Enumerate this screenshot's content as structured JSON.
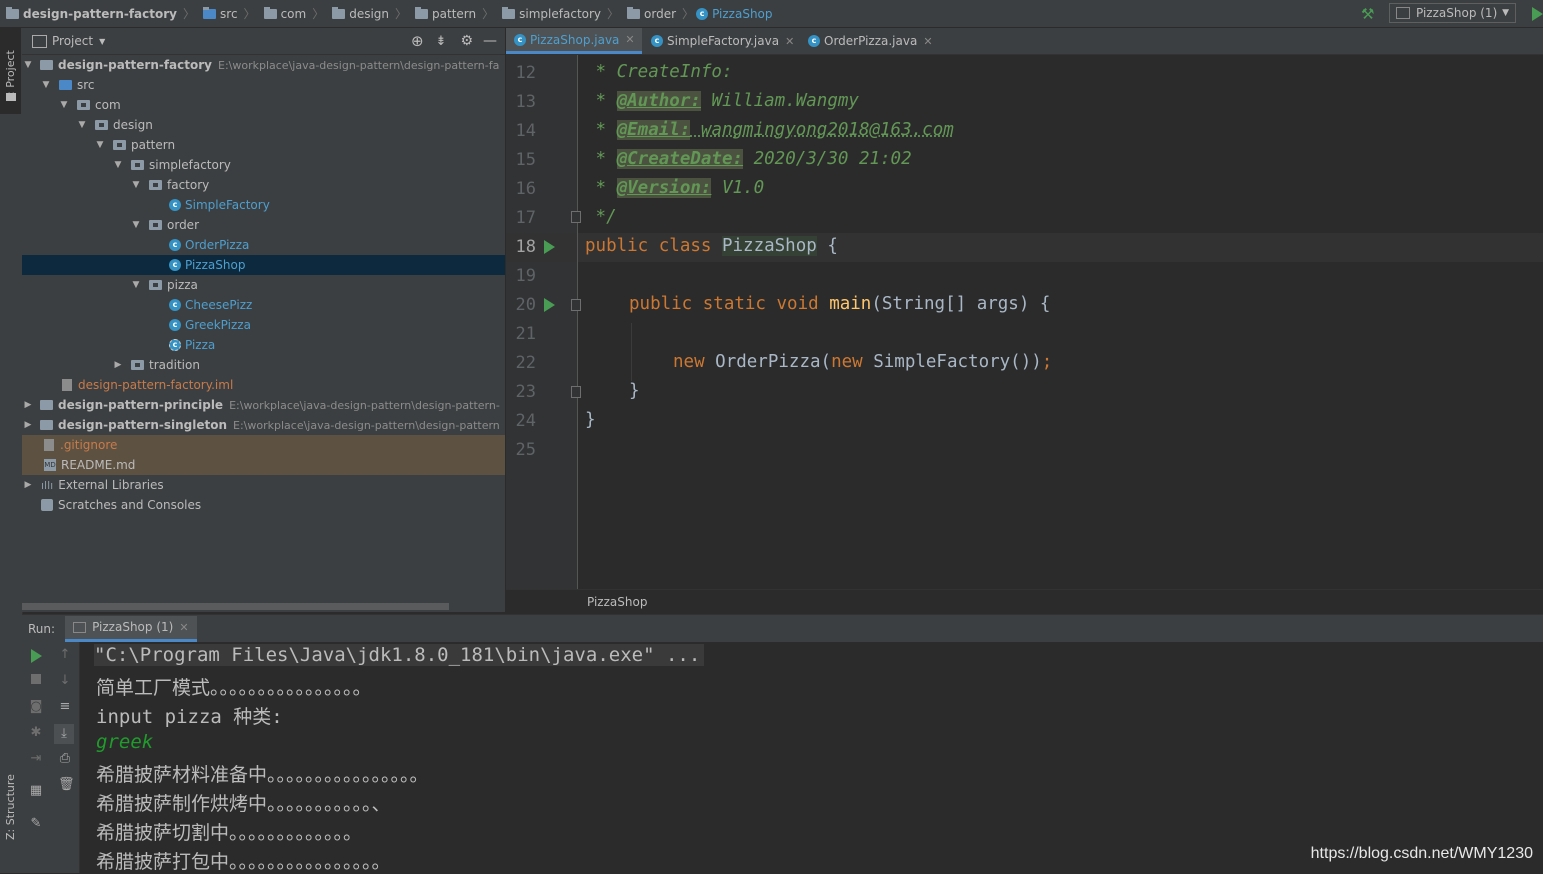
{
  "navbar": {
    "crumbs": [
      "design-pattern-factory",
      "src",
      "com",
      "design",
      "pattern",
      "simplefactory",
      "order",
      "PizzaShop"
    ],
    "run_config": "PizzaShop (1)"
  },
  "left_stripe": {
    "project_label": "1: Project",
    "structure_label": "Z: Structure"
  },
  "project_panel": {
    "title": "Project",
    "tree": [
      {
        "label": "design-pattern-factory",
        "path": "E:\\workplace\\java-design-pattern\\design-pattern-fa"
      },
      {
        "label": "src"
      },
      {
        "label": "com"
      },
      {
        "label": "design"
      },
      {
        "label": "pattern"
      },
      {
        "label": "simplefactory"
      },
      {
        "label": "factory"
      },
      {
        "label": "SimpleFactory"
      },
      {
        "label": "order"
      },
      {
        "label": "OrderPizza"
      },
      {
        "label": "PizzaShop"
      },
      {
        "label": "pizza"
      },
      {
        "label": "CheesePizz"
      },
      {
        "label": "GreekPizza"
      },
      {
        "label": "Pizza"
      },
      {
        "label": "tradition"
      },
      {
        "label": "design-pattern-factory.iml"
      },
      {
        "label": "design-pattern-principle",
        "path": "E:\\workplace\\java-design-pattern\\design-pattern-"
      },
      {
        "label": "design-pattern-singleton",
        "path": "E:\\workplace\\java-design-pattern\\design-pattern"
      },
      {
        "label": ".gitignore"
      },
      {
        "label": "README.md"
      },
      {
        "label": "External Libraries"
      },
      {
        "label": "Scratches and Consoles"
      }
    ]
  },
  "editor": {
    "tabs": [
      "PizzaShop.java",
      "SimpleFactory.java",
      "OrderPizza.java"
    ],
    "line_numbers": [
      "12",
      "13",
      "14",
      "15",
      "16",
      "17",
      "18",
      "19",
      "20",
      "21",
      "22",
      "23",
      "24",
      "25"
    ],
    "code": {
      "l12_star": " * ",
      "l12_text": "CreateInfo:",
      "l13_star": " * ",
      "l13_tag": "@Author:",
      "l13_text": " William.Wangmy",
      "l14_star": " * ",
      "l14_tag": "@Email:",
      "l14_text": " wangmingyong2018@163.com",
      "l15_star": " * ",
      "l15_tag": "@CreateDate:",
      "l15_text": " 2020/3/30 21:02",
      "l16_star": " * ",
      "l16_tag": "@Version:",
      "l16_text": " V1.0",
      "l17": " */",
      "l18_kw": "public class ",
      "l18_name": "PizzaShop",
      "l18_rest": " {",
      "l20_kw": "public static void ",
      "l20_fn": "main",
      "l20_rest": "(String[] args) {",
      "l22_kw1": "new ",
      "l22_a": "OrderPizza(",
      "l22_kw2": "new ",
      "l22_b": "SimpleFactory())",
      "l22_semi": ";",
      "l23": "}",
      "l24": "}"
    },
    "breadcrumb": "PizzaShop"
  },
  "run_panel": {
    "label": "Run:",
    "tab": "PizzaShop (1)",
    "console": [
      "\"C:\\Program Files\\Java\\jdk1.8.0_181\\bin\\java.exe\" ...",
      "简单工厂模式。。。。。。。。。。。。。。。。",
      "input pizza 种类:",
      "greek",
      "希腊披萨材料准备中。。。。。。。。。。。。。。。。",
      "希腊披萨制作烘烤中。。。。。。。。。。。、",
      "希腊披萨切割中。。。。。。。。。。。。。",
      "希腊披萨打包中。。。。。。。。。。。。。。。。"
    ]
  },
  "watermark": "https://blog.csdn.net/WMY1230",
  "colors": {
    "selection": "#0d293e",
    "ignored_bg": "#5d5141",
    "run_green": "#499c54",
    "input_green": "#6a8759"
  }
}
